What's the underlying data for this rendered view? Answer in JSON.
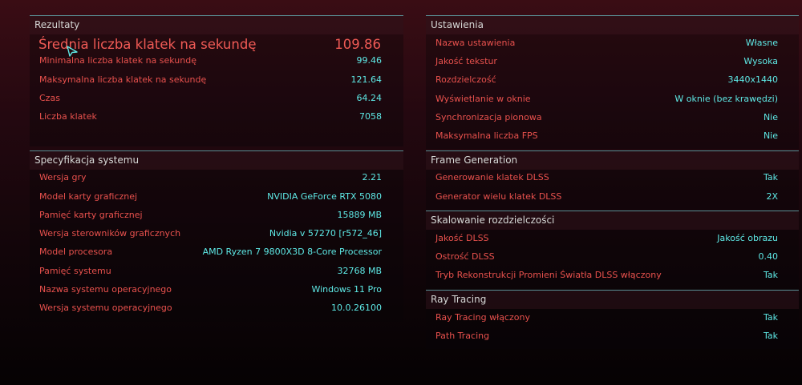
{
  "results": {
    "title": "Rezultaty",
    "avg_fps": {
      "label": "Średnia liczba klatek na sekundę",
      "value": "109.86"
    },
    "rows": [
      {
        "label": "Minimalna liczba klatek na sekundę",
        "value": "99.46"
      },
      {
        "label": "Maksymalna liczba klatek na sekundę",
        "value": "121.64"
      },
      {
        "label": "Czas",
        "value": "64.24"
      },
      {
        "label": "Liczba klatek",
        "value": "7058"
      }
    ]
  },
  "system": {
    "title": "Specyfikacja systemu",
    "rows": [
      {
        "label": "Wersja gry",
        "value": "2.21"
      },
      {
        "label": "Model karty graficznej",
        "value": "NVIDIA GeForce RTX 5080"
      },
      {
        "label": "Pamięć karty graficznej",
        "value": "15889 MB"
      },
      {
        "label": "Wersja sterowników graficznych",
        "value": "Nvidia v 57270 [r572_46]"
      },
      {
        "label": "Model procesora",
        "value": "AMD Ryzen 7 9800X3D 8-Core Processor"
      },
      {
        "label": "Pamięć systemu",
        "value": "32768 MB"
      },
      {
        "label": "Nazwa systemu operacyjnego",
        "value": "Windows 11 Pro"
      },
      {
        "label": "Wersja systemu operacyjnego",
        "value": "10.0.26100"
      }
    ]
  },
  "settings": {
    "title": "Ustawienia",
    "rows": [
      {
        "label": "Nazwa ustawienia",
        "value": "Własne"
      },
      {
        "label": "Jakość tekstur",
        "value": "Wysoka"
      },
      {
        "label": "Rozdzielczość",
        "value": "3440x1440"
      },
      {
        "label": "Wyświetlanie w oknie",
        "value": "W oknie (bez krawędzi)"
      },
      {
        "label": "Synchronizacja pionowa",
        "value": "Nie"
      },
      {
        "label": "Maksymalna liczba FPS",
        "value": "Nie"
      }
    ]
  },
  "frame_generation": {
    "title": "Frame Generation",
    "rows": [
      {
        "label": "Generowanie klatek DLSS",
        "value": "Tak"
      },
      {
        "label": "Generator wielu klatek DLSS",
        "value": "2X"
      }
    ]
  },
  "scaling": {
    "title": "Skalowanie rozdzielczości",
    "rows": [
      {
        "label": "Jakość DLSS",
        "value": "Jakość obrazu"
      },
      {
        "label": "Ostrość DLSS",
        "value": "0.40"
      },
      {
        "label": "Tryb Rekonstrukcji Promieni Światła DLSS włączony",
        "value": "Tak"
      }
    ]
  },
  "ray_tracing": {
    "title": "Ray Tracing",
    "rows": [
      {
        "label": "Ray Tracing włączony",
        "value": "Tak"
      },
      {
        "label": "Path Tracing",
        "value": "Tak"
      }
    ]
  },
  "colors": {
    "label_red": "#e8514d",
    "value_cyan": "#5ee9e6",
    "header_text": "#d6d8d6",
    "border_teal": "#5a8f94"
  }
}
